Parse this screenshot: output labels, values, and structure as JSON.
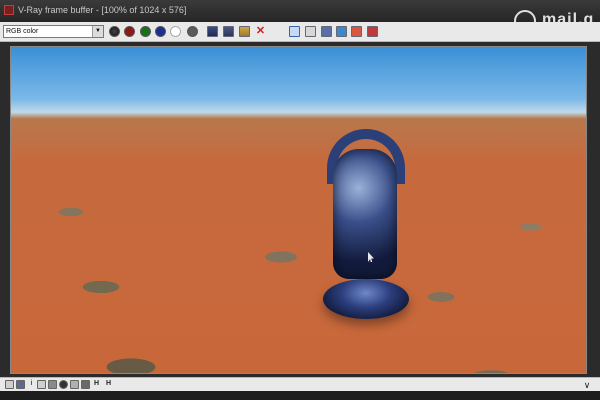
{
  "window": {
    "title": "V-Ray frame buffer - [100% of 1024 x 576]",
    "watermark_text": "mail.g"
  },
  "toolbar": {
    "channel": "RGB color",
    "channel_options": [
      "RGB color"
    ],
    "icons": [
      "channel-color-icon",
      "red-channel-icon",
      "green-channel-icon",
      "blue-channel-icon",
      "white-swatch-icon",
      "alpha-channel-icon",
      "save-image-icon",
      "save-all-icon",
      "load-image-icon",
      "clear-image-icon",
      "track-mouse-icon",
      "region-render-icon",
      "render-last-icon",
      "vfb-history-icon",
      "color-correct-icon",
      "lens-effects-icon"
    ],
    "colors": {
      "red": "#8b1a1a",
      "green": "#1c6e1c",
      "blue": "#1f2f8f",
      "white": "#ffffff",
      "alpha": "#5a5a5a"
    }
  },
  "bottom_bar": {
    "letters": [
      "H",
      "H"
    ],
    "icons": [
      "frame-icon",
      "level-icon",
      "info-icon",
      "cursor-info-icon",
      "lut-icon",
      "correction-icon",
      "stamp-icon",
      "lens-icon"
    ],
    "expand_glyph": "∨"
  }
}
